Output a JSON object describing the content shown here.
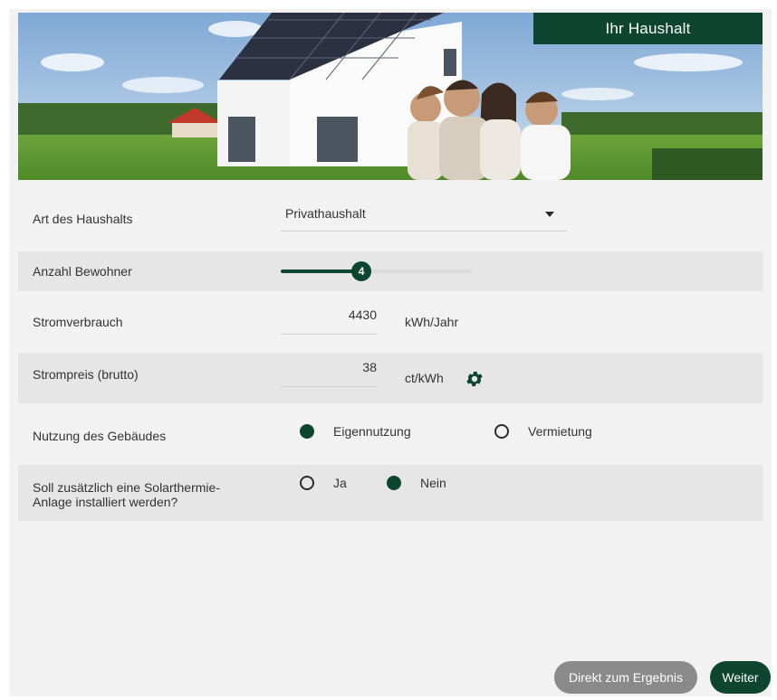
{
  "hero": {
    "title": "Ihr Haushalt"
  },
  "form": {
    "household_type": {
      "label": "Art des Haushalts",
      "value": "Privathaushalt"
    },
    "residents": {
      "label": "Anzahl Bewohner",
      "value": "4",
      "level_fraction": 0.42
    },
    "consumption": {
      "label": "Stromverbrauch",
      "value": "4430",
      "unit": "kWh/Jahr"
    },
    "price": {
      "label": "Strompreis (brutto)",
      "value": "38",
      "unit": "ct/kWh",
      "settings_icon": "gear-icon"
    },
    "usage": {
      "label": "Nutzung des Gebäudes",
      "options": [
        "Eigennutzung",
        "Vermietung"
      ],
      "selected": "Eigennutzung"
    },
    "solar_thermal": {
      "label_line1": "Soll zusätzlich eine Solarthermie-",
      "label_line2": "Anlage installiert werden?",
      "options": [
        "Ja",
        "Nein"
      ],
      "selected": "Nein"
    }
  },
  "actions": {
    "direct_label": "Direkt zum Ergebnis",
    "next_label": "Weiter"
  },
  "colors": {
    "accent": "#0d4530",
    "secondary_button": "#8a8a8a",
    "panel": "#f2f2f2",
    "row_shade": "#e6e6e6"
  }
}
